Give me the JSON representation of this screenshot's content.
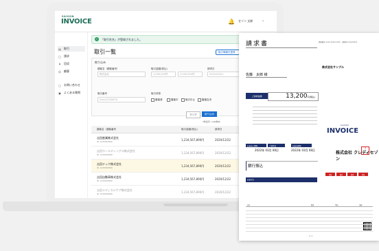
{
  "app": {
    "logo_small": "SAISON",
    "logo_main": "INVOICE"
  },
  "header": {
    "user_name": "セゾン 太郎"
  },
  "sidebar": {
    "items": [
      {
        "label": "取引",
        "icon": "document-icon",
        "active": true
      },
      {
        "label": "請求",
        "icon": "invoice-icon",
        "active": false
      },
      {
        "label": "回収",
        "icon": "yen-icon",
        "active": false
      },
      {
        "label": "顧客",
        "icon": "people-icon",
        "active": false
      },
      {
        "label": "お問い合わせ",
        "icon": "chat-icon",
        "active": false
      },
      {
        "label": "よくある質問",
        "icon": "book-icon",
        "active": false
      }
    ]
  },
  "main": {
    "toast": "「取引先名」が登録されました。",
    "title": "取引一覧",
    "register_button": "取引情報を登録",
    "filter": {
      "title": "絞り込み",
      "customer_label": "顧客名（顧客番号）",
      "amount_label": "取引金額(税込)",
      "date_label": "請求日",
      "customer_placeholder": "株式会社",
      "amount_from": "1,000,000円",
      "amount_to": "2,000,000円",
      "date_from": "2022/03/01",
      "number_label": "取引番号",
      "number_placeholder": "Dms12345678",
      "status_label": "取引状態",
      "statuses": [
        "審査済",
        "審査中",
        "取引中止",
        "審査否決"
      ],
      "clear_button": "クリア",
      "search_button": "絞り込み"
    },
    "count_text": "7件表示 / 100件中",
    "table": {
      "headers": [
        "顧客名・顧客番号",
        "取引金額(税込)",
        "請求日",
        "期日"
      ],
      "rows": [
        {
          "name": "吉田産業株式会社",
          "id": "ID: 1234567890",
          "amount": "1,234,567,890円",
          "date": "2020/12/22",
          "dim": false,
          "highlight": false
        },
        {
          "name": "吉田ホールディングス株式会社",
          "id": "ID: 1234567890",
          "amount": "1,234,567,890円",
          "date": "2020/12/22",
          "dim": true,
          "highlight": false
        },
        {
          "name": "吉田テック株式会社",
          "id": "ID: 1234567890",
          "amount": "1,234,567,890円",
          "date": "2020/12/22",
          "dim": false,
          "highlight": true
        },
        {
          "name": "吉田自動車株式会社",
          "id": "ID: 1234567890",
          "amount": "1,234,567,890円",
          "date": "2020/12/22",
          "dim": false,
          "highlight": false
        },
        {
          "name": "吉田メディカルケア株式会社",
          "id": "ID: 1234567890",
          "amount": "1,234,567,890円",
          "date": "2020/12/22",
          "dim": true,
          "highlight": false
        }
      ]
    }
  },
  "invoice": {
    "title": "請求書",
    "number_text": "請求番号 xxxx-xxxxx-xxxx　請求日 xxxx/xx/xx",
    "recipient": "佐藤　太郎 様",
    "issuer_company": "株式会社サンプル",
    "amount_label": "ご請求金額",
    "amount": "13,200",
    "amount_suffix": "円(税込)",
    "due_labels": [
      "お支払い期限",
      "ご請求日",
      "お振込期限"
    ],
    "due_dates": [
      "2022年 03月 08日",
      "2022年 03月 08日"
    ],
    "bank_title": "銀行振込",
    "bank_section": "お振込先",
    "logo_small": "SAISON",
    "logo_main": "INVOICE",
    "brand": "株式会社 クレディセゾン",
    "stamp_text": "印",
    "tags": [
      "登録",
      "確定",
      "請求",
      "回収"
    ],
    "items_header": [
      "品名",
      "数量",
      "単価",
      "金額"
    ],
    "page_number": "1 / 1"
  }
}
